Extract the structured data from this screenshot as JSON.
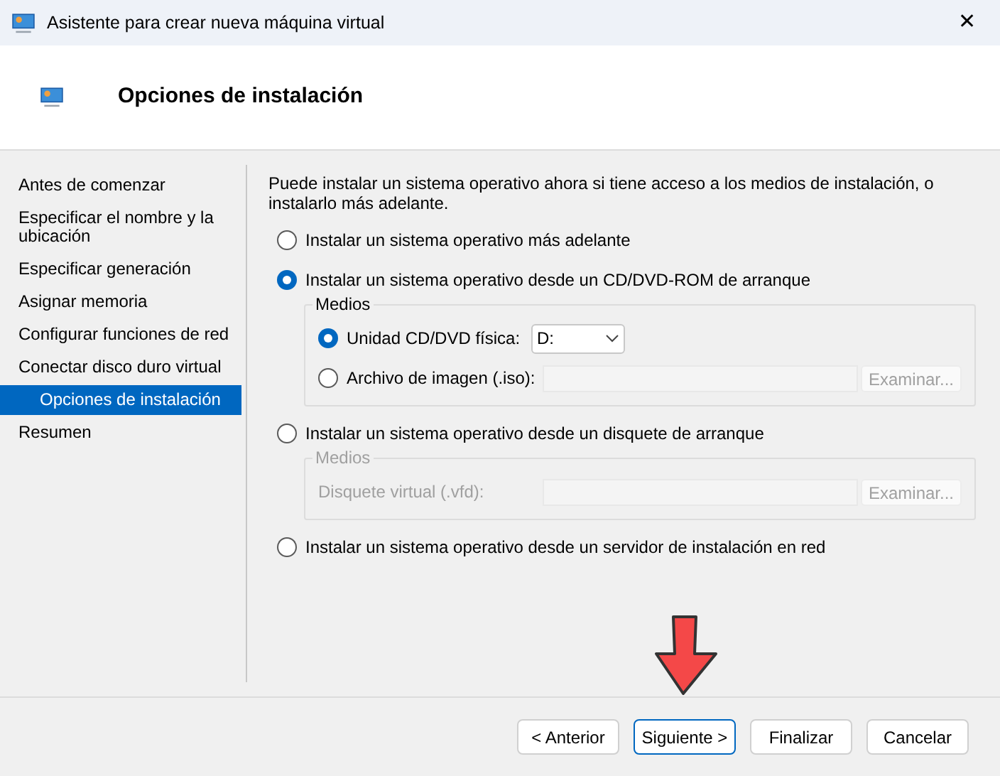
{
  "window": {
    "title": "Asistente para crear nueva máquina virtual",
    "close": "✕"
  },
  "header": {
    "title": "Opciones de instalación"
  },
  "steps": [
    {
      "label": "Antes de comenzar",
      "selected": false
    },
    {
      "label": "Especificar el nombre y la ubicación",
      "selected": false
    },
    {
      "label": "Especificar generación",
      "selected": false
    },
    {
      "label": "Asignar memoria",
      "selected": false
    },
    {
      "label": "Configurar funciones de red",
      "selected": false
    },
    {
      "label": "Conectar disco duro virtual",
      "selected": false
    },
    {
      "label": "Opciones de instalación",
      "selected": true
    },
    {
      "label": "Resumen",
      "selected": false
    }
  ],
  "description": "Puede instalar un sistema operativo ahora si tiene acceso a los medios de instalación, o instalarlo más adelante.",
  "options": [
    {
      "label": "Instalar un sistema operativo más adelante",
      "selected": false
    },
    {
      "label": "Instalar un sistema operativo desde un CD/DVD-ROM de arranque",
      "selected": true,
      "media": {
        "title": "Medios",
        "disabled": false,
        "rows": [
          {
            "kind": "radio",
            "label": "Unidad CD/DVD física:",
            "selected": true,
            "dropdown": "D:"
          },
          {
            "kind": "radio",
            "label": "Archivo de imagen (.iso):",
            "selected": false,
            "browse": "Examinar..."
          }
        ]
      }
    },
    {
      "label": "Instalar un sistema operativo desde un disquete de arranque",
      "selected": false,
      "media": {
        "title": "Medios",
        "disabled": true,
        "rows": [
          {
            "kind": "label",
            "label": "Disquete virtual (.vfd):",
            "browse": "Examinar..."
          }
        ]
      }
    },
    {
      "label": "Instalar un sistema operativo desde un servidor de instalación en red",
      "selected": false
    }
  ],
  "buttons": [
    {
      "label": "< Anterior",
      "focused": false
    },
    {
      "label": "Siguiente >",
      "focused": true
    },
    {
      "label": "Finalizar",
      "focused": false
    },
    {
      "label": "Cancelar",
      "focused": false
    }
  ]
}
